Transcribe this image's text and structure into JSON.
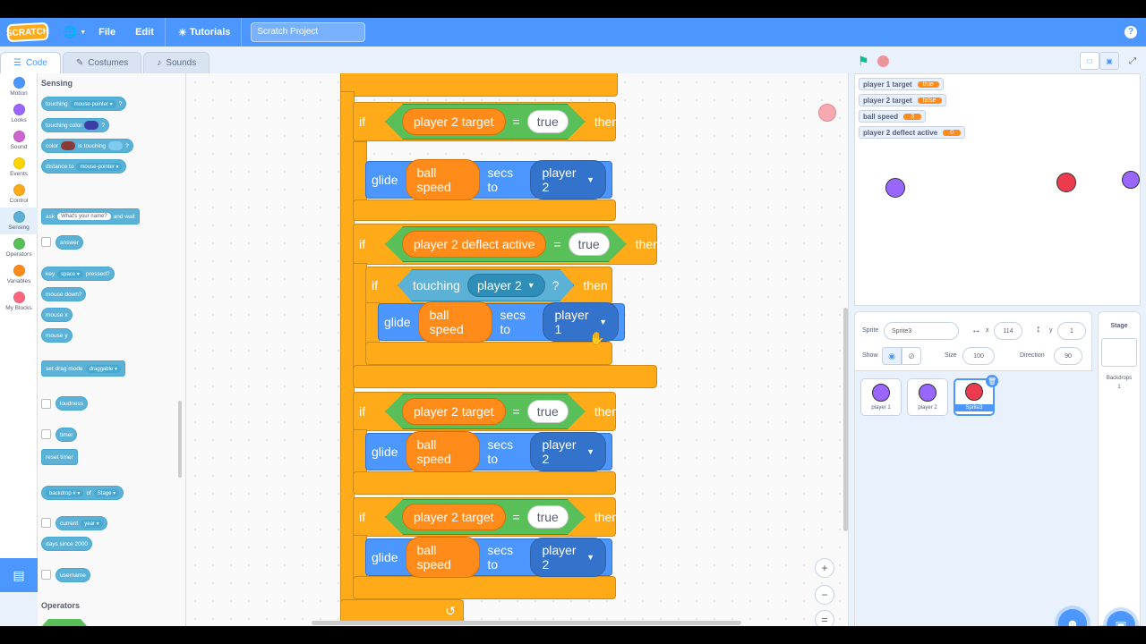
{
  "menubar": {
    "logo": "SCRATCH",
    "file": "File",
    "edit": "Edit",
    "tutorials": "Tutorials",
    "project_title": "Scratch Project",
    "help": "?"
  },
  "tabs": {
    "code": "Code",
    "costumes": "Costumes",
    "sounds": "Sounds"
  },
  "categories": [
    {
      "label": "Motion",
      "color": "#4c97ff"
    },
    {
      "label": "Looks",
      "color": "#9966ff"
    },
    {
      "label": "Sound",
      "color": "#cf63cf"
    },
    {
      "label": "Events",
      "color": "#ffd500"
    },
    {
      "label": "Control",
      "color": "#ffab19"
    },
    {
      "label": "Sensing",
      "color": "#5cb1d6"
    },
    {
      "label": "Operators",
      "color": "#59c059"
    },
    {
      "label": "Variables",
      "color": "#ff8c1a"
    },
    {
      "label": "My Blocks",
      "color": "#ff6680"
    }
  ],
  "palette": {
    "sensing_header": "Sensing",
    "operators_header": "Operators",
    "touching": "touching",
    "mouse_pointer": "mouse-pointer",
    "q": "?",
    "touching_color": "touching color",
    "color": "color",
    "is_touching": "is touching",
    "distance_to": "distance to",
    "ask": "ask",
    "whats_your_name": "What's your name?",
    "and_wait": "and wait",
    "answer": "answer",
    "key": "key",
    "space": "space",
    "pressed": "pressed?",
    "mouse_down": "mouse down?",
    "mouse_x": "mouse x",
    "mouse_y": "mouse y",
    "set_drag_mode": "set drag mode",
    "draggable": "draggable",
    "loudness": "loudness",
    "timer": "timer",
    "reset_timer": "reset timer",
    "backdrop_num": "backdrop #",
    "of": "of",
    "stage": "Stage",
    "current": "current",
    "year": "year",
    "days_since": "days since 2000",
    "username": "username"
  },
  "script": {
    "if": "if",
    "then": "then",
    "eq": "=",
    "true": "true",
    "player2_target": "player 2 target",
    "player2_deflect_active": "player 2 deflect active",
    "glide": "glide",
    "ball_speed": "ball speed",
    "secs_to": "secs to",
    "player2": "player 2",
    "player1": "player 1",
    "touching": "touching",
    "q": "?",
    "zoom_in": "+",
    "zoom_out": "−",
    "zoom_reset": "="
  },
  "monitors": [
    {
      "label": "player 1 target",
      "value": "true"
    },
    {
      "label": "player 2 target",
      "value": "false"
    },
    {
      "label": "ball speed",
      "value": "3"
    },
    {
      "label": "player 2 deflect active",
      "value": "0"
    }
  ],
  "sprite_info": {
    "sprite_label": "Sprite",
    "sprite_name": "Sprite3",
    "x_label": "x",
    "x_value": "114",
    "y_label": "y",
    "y_value": "1",
    "show_label": "Show",
    "size_label": "Size",
    "size_value": "100",
    "direction_label": "Direction",
    "direction_value": "90"
  },
  "sprites": [
    {
      "name": "player 1",
      "color": "#9966ff"
    },
    {
      "name": "player 2",
      "color": "#9966ff"
    },
    {
      "name": "Sprite3",
      "color": "#ec3b4e"
    }
  ],
  "stage_panel": {
    "title": "Stage",
    "backdrops_label": "Backdrops",
    "backdrops_count": "1"
  }
}
